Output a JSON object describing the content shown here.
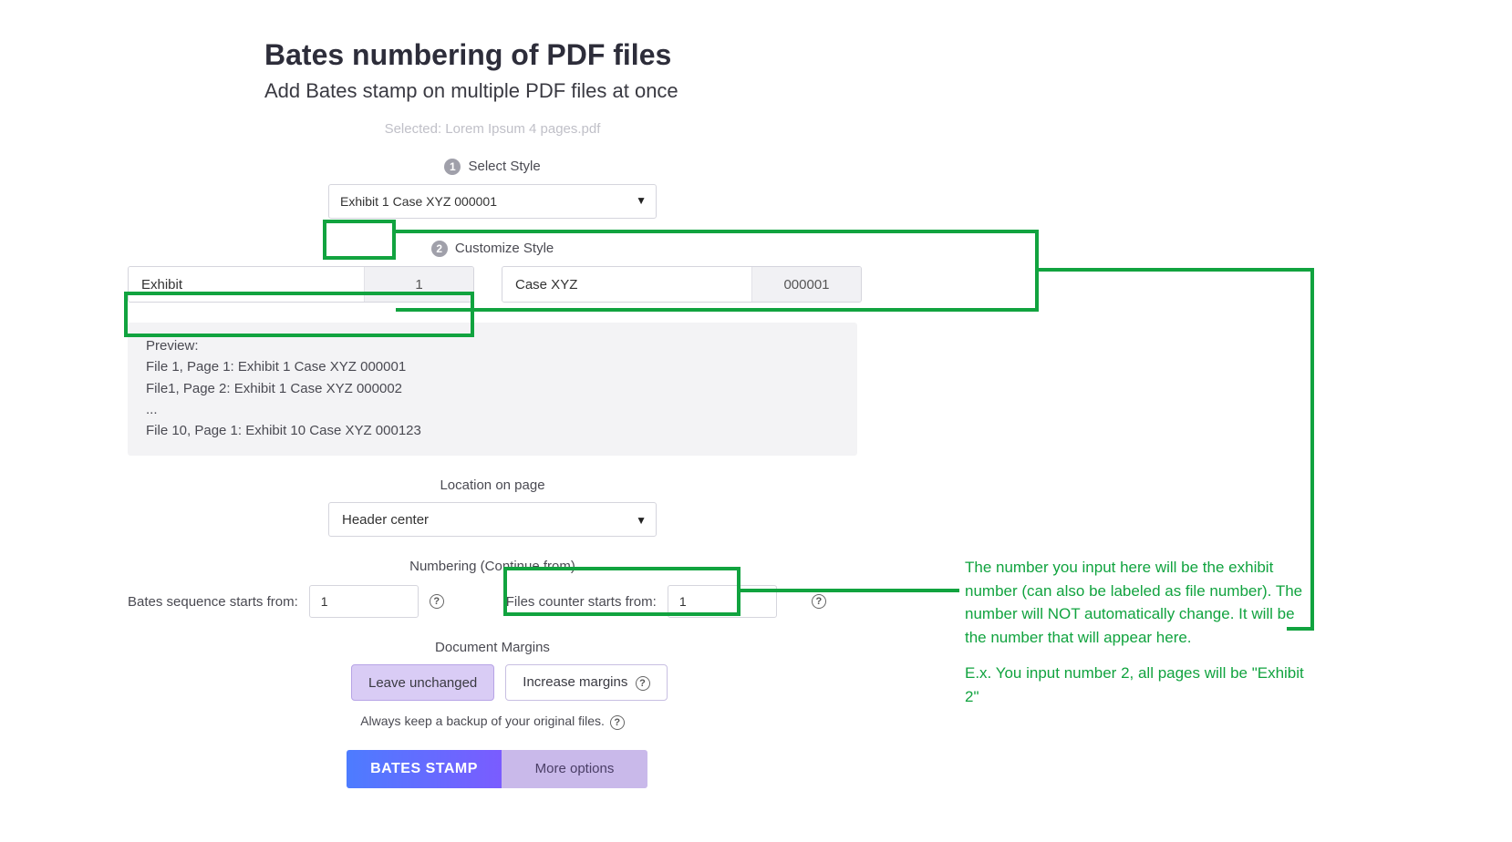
{
  "header": {
    "title": "Bates numbering of PDF files",
    "subtitle": "Add Bates stamp on multiple PDF files at once",
    "selected_prefix": "Selected: ",
    "selected_file": "Lorem Ipsum 4 pages.pdf"
  },
  "steps": {
    "step1_num": "1",
    "step1_label": "Select Style",
    "step2_num": "2",
    "step2_label": "Customize Style"
  },
  "style_select": {
    "value": "Exhibit 1 Case XYZ 000001"
  },
  "customize": {
    "prefix_text": "Exhibit",
    "prefix_number": "1",
    "case_text": "Case XYZ",
    "case_number": "000001"
  },
  "preview": {
    "label": "Preview:",
    "line1": "File 1, Page 1: Exhibit 1 Case XYZ 000001",
    "line2": "File1, Page 2: Exhibit 1 Case XYZ 000002",
    "line3": "...",
    "line4": "File 10, Page 1: Exhibit 10 Case XYZ 000123"
  },
  "location": {
    "label": "Location on page",
    "value": "Header center"
  },
  "numbering": {
    "section_label": "Numbering (Continue from)",
    "bates_label": "Bates sequence starts from:",
    "bates_value": "1",
    "files_label": "Files counter starts from:",
    "files_value": "1"
  },
  "margins": {
    "label": "Document Margins",
    "leave": "Leave unchanged",
    "increase": "Increase margins"
  },
  "backup_note": "Always keep a backup of your original files.",
  "actions": {
    "primary": "BATES STAMP",
    "secondary": "More options"
  },
  "annotations": {
    "text1": "The number you input here will be the exhibit number (can also be labeled as file number). The number will NOT automatically change. It will be the number that will appear here.",
    "text2": "E.x. You input number 2, all pages will be \"Exhibit 2\""
  }
}
